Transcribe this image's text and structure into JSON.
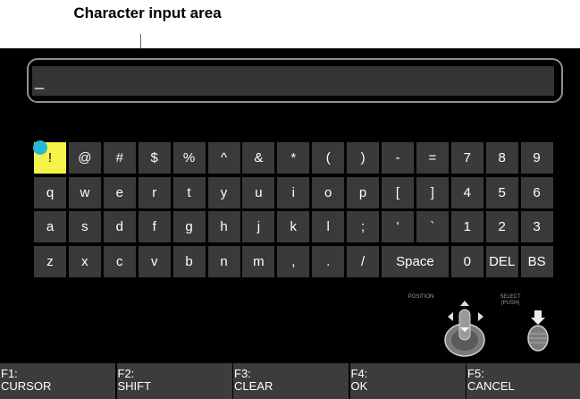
{
  "annotation": {
    "label": "Character input area"
  },
  "input": {
    "value": "_"
  },
  "keyboard": {
    "rows": [
      [
        "!",
        "@",
        "#",
        "$",
        "%",
        "^",
        "&",
        "*",
        "(",
        ")",
        "-",
        "=",
        "7",
        "8",
        "9"
      ],
      [
        "q",
        "w",
        "e",
        "r",
        "t",
        "y",
        "u",
        "i",
        "o",
        "p",
        "[",
        "]",
        "4",
        "5",
        "6"
      ],
      [
        "a",
        "s",
        "d",
        "f",
        "g",
        "h",
        "j",
        "k",
        "l",
        ";",
        "'",
        "`",
        "1",
        "2",
        "3"
      ],
      [
        "z",
        "x",
        "c",
        "v",
        "b",
        "n",
        "m",
        ",",
        ".",
        "/",
        "Space",
        "0",
        "DEL",
        "BS"
      ]
    ],
    "selected_key": "!"
  },
  "controls": {
    "position_label": "POSITION",
    "select_label": "SELECT\n(PUSH)"
  },
  "function_keys": [
    {
      "num": "F1:",
      "action": "CURSOR"
    },
    {
      "num": "F2:",
      "action": "SHIFT"
    },
    {
      "num": "F3:",
      "action": "CLEAR"
    },
    {
      "num": "F4:",
      "action": "OK"
    },
    {
      "num": "F5:",
      "action": "CANCEL"
    }
  ],
  "colors": {
    "selected_key": "#f5f34a",
    "cursor_dot": "#24b8d6",
    "key_bg": "#3a3a3a",
    "screen_bg": "#000000"
  }
}
